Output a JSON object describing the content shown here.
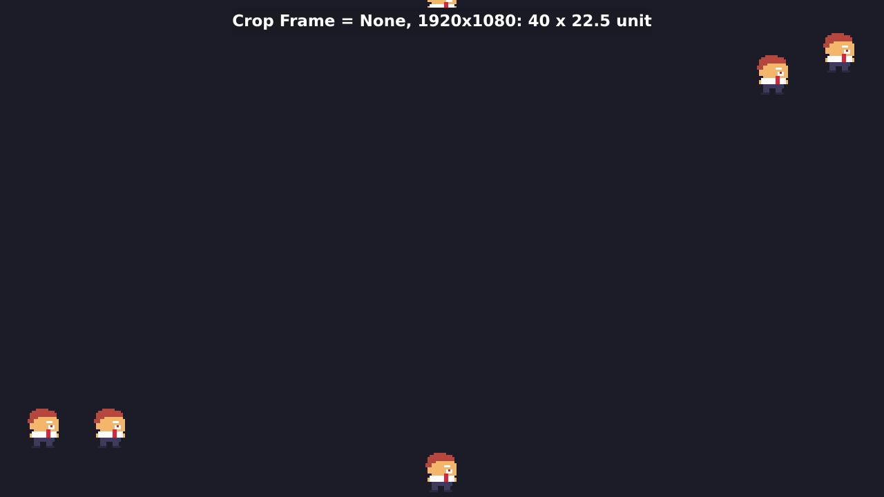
{
  "overlay": {
    "caption": "Crop Frame = None, 1920x1080: 40 x 22.5 unit"
  },
  "scene": {
    "background_color": "#1c1c29",
    "sprite_count": 6,
    "character": {
      "hair_color": "#b5473f",
      "skin_color": "#f3b66b",
      "shirt_color": "#ffffff",
      "tie_color": "#d9263a",
      "pants_color": "#3d3a5c"
    }
  }
}
